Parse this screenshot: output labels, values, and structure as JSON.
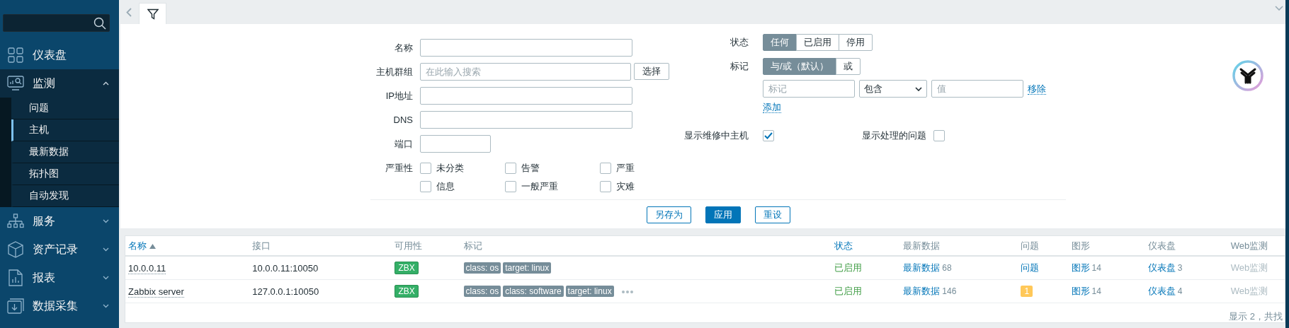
{
  "sidebar": {
    "items": [
      {
        "label": "仪表盘"
      },
      {
        "label": "监测",
        "expanded": true,
        "children": [
          {
            "label": "问题",
            "selected": false
          },
          {
            "label": "主机",
            "selected": true
          },
          {
            "label": "最新数据",
            "selected": false
          },
          {
            "label": "拓扑图",
            "selected": false
          },
          {
            "label": "自动发现",
            "selected": false
          }
        ]
      },
      {
        "label": "服务",
        "expanded": false
      },
      {
        "label": "资产记录",
        "expanded": false
      },
      {
        "label": "报表",
        "expanded": false
      },
      {
        "label": "数据采集",
        "expanded": false
      }
    ]
  },
  "filter": {
    "fields": [
      {
        "label": "名称",
        "kind": "text"
      },
      {
        "label": "主机群组",
        "kind": "multiselect",
        "placeholder": "在此输入搜索",
        "button": "选择"
      },
      {
        "label": "IP地址",
        "kind": "text"
      },
      {
        "label": "DNS",
        "kind": "text"
      },
      {
        "label": "端口",
        "kind": "short"
      }
    ],
    "severity": {
      "label": "严重性",
      "options": [
        {
          "label": "未分类",
          "checked": false
        },
        {
          "label": "告警",
          "checked": false
        },
        {
          "label": "严重",
          "checked": false
        },
        {
          "label": "信息",
          "checked": false
        },
        {
          "label": "一般严重",
          "checked": false
        },
        {
          "label": "灾难",
          "checked": false
        }
      ]
    },
    "status": {
      "label": "状态",
      "options": [
        {
          "label": "任何",
          "selected": true
        },
        {
          "label": "已启用",
          "selected": false
        },
        {
          "label": "停用",
          "selected": false
        }
      ]
    },
    "tags": {
      "label": "标记",
      "operators": [
        {
          "label": "与/或（默认）",
          "selected": true
        },
        {
          "label": "或",
          "selected": false
        }
      ],
      "rows": [
        {
          "tag_placeholder": "标记",
          "operator": "包含",
          "value_placeholder": "值",
          "remove": "移除"
        }
      ],
      "add": "添加"
    },
    "show_maintenance": {
      "label": "显示维修中主机",
      "checked": true
    },
    "show_suppressed": {
      "label": "显示处理的问题",
      "checked": false
    },
    "buttons": [
      {
        "label": "另存为",
        "kind": "secondary"
      },
      {
        "label": "应用",
        "kind": "primary"
      },
      {
        "label": "重设",
        "kind": "secondary"
      }
    ]
  },
  "table": {
    "columns": [
      {
        "label": "名称",
        "sortable": true,
        "sorted": true
      },
      {
        "label": "接口",
        "sortable": false,
        "sorted": false
      },
      {
        "label": "可用性",
        "sortable": false,
        "sorted": false
      },
      {
        "label": "标记",
        "sortable": false,
        "sorted": false
      },
      {
        "label": "状态",
        "sortable": true,
        "sorted": false
      },
      {
        "label": "最新数据",
        "sortable": false,
        "sorted": false
      },
      {
        "label": "问题",
        "sortable": false,
        "sorted": false
      },
      {
        "label": "图形",
        "sortable": false,
        "sorted": false
      },
      {
        "label": "仪表盘",
        "sortable": false,
        "sorted": false
      },
      {
        "label": "Web监测",
        "sortable": false,
        "sorted": false
      }
    ],
    "rows": [
      {
        "name": "10.0.0.11",
        "interface": "10.0.0.11:10050",
        "availability": {
          "label": "ZBX",
          "available": true
        },
        "tags": [
          "class: os",
          "target: linux"
        ],
        "more_tags": false,
        "status": "已启用",
        "latest_data": {
          "label": "最新数据",
          "count": "68"
        },
        "problems": {
          "kind": "link",
          "text": "问题"
        },
        "graphs": {
          "label": "图形",
          "count": "14"
        },
        "dashboards": {
          "label": "仪表盘",
          "count": "3"
        },
        "web": {
          "label": "Web监测",
          "disabled": true
        }
      },
      {
        "name": "Zabbix server",
        "interface": "127.0.0.1:10050",
        "availability": {
          "label": "ZBX",
          "available": true
        },
        "tags": [
          "class: os",
          "class: software",
          "target: linux"
        ],
        "more_tags": true,
        "status": "已启用",
        "latest_data": {
          "label": "最新数据",
          "count": "146"
        },
        "problems": {
          "kind": "count",
          "text": "1"
        },
        "graphs": {
          "label": "图形",
          "count": "14"
        },
        "dashboards": {
          "label": "仪表盘",
          "count": "4"
        },
        "web": {
          "label": "Web监测",
          "disabled": true
        }
      }
    ],
    "footer": "显示 2，共找"
  }
}
